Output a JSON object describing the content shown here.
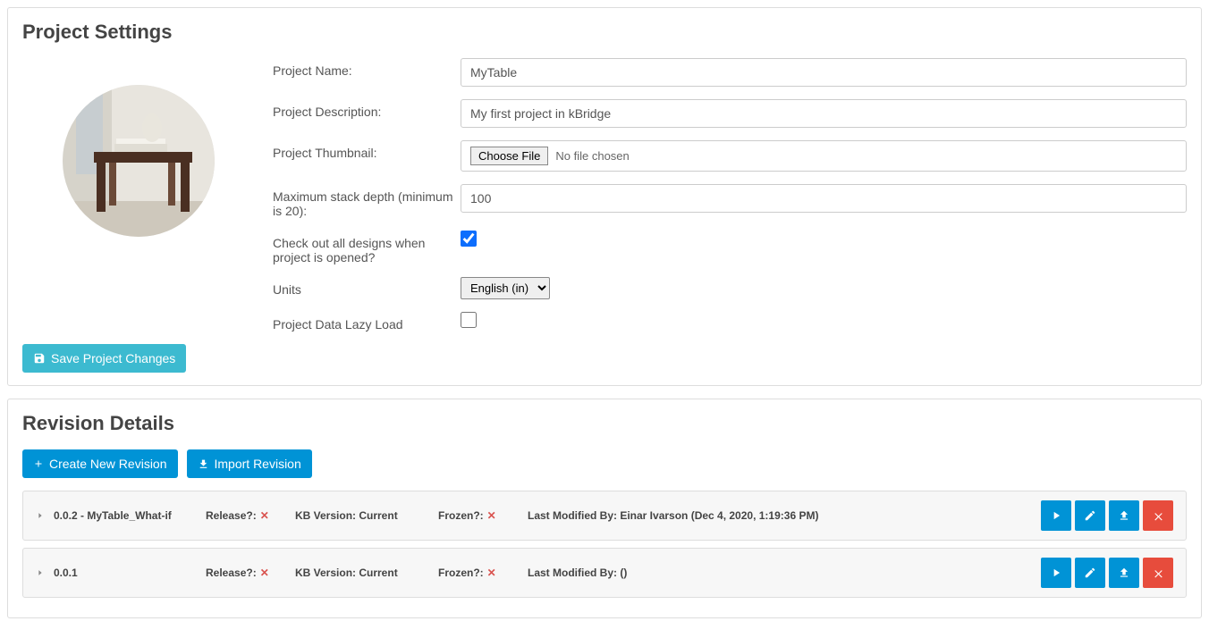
{
  "settings": {
    "title": "Project Settings",
    "labels": {
      "name": "Project Name:",
      "desc": "Project Description:",
      "thumb": "Project Thumbnail:",
      "stack": "Maximum stack depth (minimum is 20):",
      "checkout": "Check out all designs when project is opened?",
      "units": "Units",
      "lazy": "Project Data Lazy Load"
    },
    "values": {
      "name": "MyTable",
      "desc": "My first project in kBridge",
      "file_btn": "Choose File",
      "file_status": "No file chosen",
      "stack": "100",
      "checkout": true,
      "units": "English (in)",
      "lazy": false
    },
    "save_btn": "Save Project Changes"
  },
  "revisions": {
    "title": "Revision Details",
    "create_btn": "Create New Revision",
    "import_btn": "Import Revision",
    "labels": {
      "release": "Release?:",
      "kb": "KB Version:",
      "frozen": "Frozen?:",
      "modified": "Last Modified By:"
    },
    "rows": [
      {
        "name": "0.0.2 - MyTable_What-if",
        "release": false,
        "kb_version": "Current",
        "frozen": false,
        "modified_by": "Einar Ivarson (Dec 4, 2020, 1:19:36 PM)"
      },
      {
        "name": "0.0.1",
        "release": false,
        "kb_version": "Current",
        "frozen": false,
        "modified_by": " ()"
      }
    ]
  }
}
